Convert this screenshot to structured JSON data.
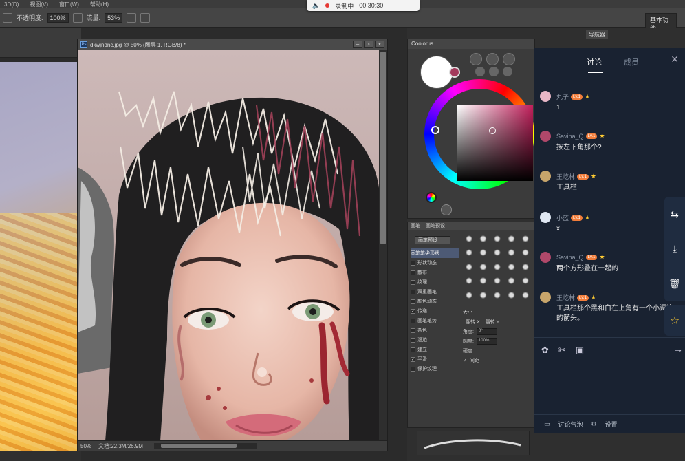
{
  "menubar": {
    "items": [
      "3D(D)",
      "视图(V)",
      "窗口(W)",
      "帮助(H)"
    ]
  },
  "optbar": {
    "opacity_label": "不透明度:",
    "opacity_value": "100%",
    "flow_label": "流量:",
    "flow_value": "53%"
  },
  "workspace": {
    "label": "基本功能"
  },
  "recording": {
    "status": "录制中",
    "time": "00:30:30"
  },
  "document": {
    "title": "dkwjndnc.jpg @ 50% (图层 1, RGB/8) *",
    "zoom": "50%",
    "doc_size": "文档:22.3M/26.9M"
  },
  "colorpanel": {
    "title": "Coolorus"
  },
  "navigator": {
    "title": "导航器"
  },
  "brushpanel": {
    "tabs": [
      "画笔",
      "画笔预设"
    ],
    "preset_button": "画笔预设",
    "options": [
      {
        "label": "画笔笔尖形状",
        "checked": false,
        "head": true
      },
      {
        "label": "形状动态",
        "checked": false
      },
      {
        "label": "散布",
        "checked": false
      },
      {
        "label": "纹理",
        "checked": false
      },
      {
        "label": "双重画笔",
        "checked": false
      },
      {
        "label": "颜色动态",
        "checked": false
      },
      {
        "label": "传递",
        "checked": true
      },
      {
        "label": "画笔笔势",
        "checked": false
      },
      {
        "label": "杂色",
        "checked": false
      },
      {
        "label": "湿边",
        "checked": false
      },
      {
        "label": "建立",
        "checked": false
      },
      {
        "label": "平滑",
        "checked": true
      },
      {
        "label": "保护纹理",
        "checked": false
      }
    ],
    "size_label": "大小",
    "flip_x": "翻转 X",
    "flip_y": "翻转 Y",
    "angle_label": "角度:",
    "angle_value": "0°",
    "roundness_label": "圆度:",
    "roundness_value": "100%",
    "hardness_label": "硬度",
    "spacing_label": "间距"
  },
  "chat": {
    "tab_discuss": "讨论",
    "tab_members": "成员",
    "messages": [
      {
        "name": "丸子",
        "text": "1",
        "avatar_color": "#e8b7c7"
      },
      {
        "name": "Savina_Q",
        "text": "按左下角那个?",
        "avatar_color": "#b0486a"
      },
      {
        "name": "王屹林",
        "text": "工具栏",
        "avatar_color": "#c7a56b"
      },
      {
        "name": "小蓝",
        "text": "x",
        "avatar_color": "#dfe7f2"
      },
      {
        "name": "Savina_Q",
        "text": "两个方形叠在一起的",
        "avatar_color": "#b0486a"
      },
      {
        "name": "王屹林",
        "text": "工具栏那个黑和白在上角有一个小调换的箭头。",
        "avatar_color": "#c7a56b"
      }
    ],
    "badge": "Lv.1",
    "footer_atmosphere": "讨论气泡",
    "footer_settings": "设置"
  }
}
